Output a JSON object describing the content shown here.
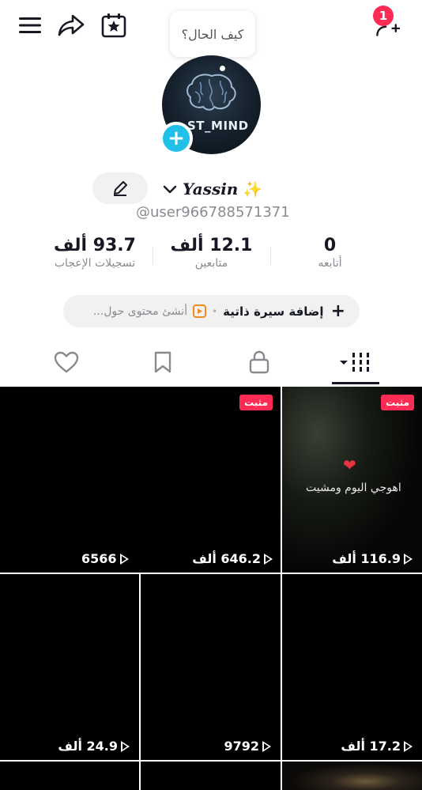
{
  "top_bar": {
    "notification_count": "1",
    "icons": [
      "menu-icon",
      "share-icon",
      "calendar-star-icon",
      "add-friend-icon"
    ]
  },
  "status_bubble": {
    "text": "كيف الحال؟"
  },
  "avatar": {
    "text": "ST_MIND"
  },
  "profile": {
    "display_name": "Yassin",
    "username": "@user966788571371"
  },
  "stats": [
    {
      "value": "93.7 ألف",
      "label": "تسجيلات الإعجاب"
    },
    {
      "value": "12.1 ألف",
      "label": "متابعين"
    },
    {
      "value": "0",
      "label": "أتابعه"
    }
  ],
  "bio": {
    "add_label": "إضافة سيرة ذاتية",
    "hint": "أنشئ محتوى حول..."
  },
  "tabs": [
    {
      "name": "liked",
      "icon": "heart-icon"
    },
    {
      "name": "favorites",
      "icon": "bookmark-icon"
    },
    {
      "name": "private",
      "icon": "lock-icon"
    },
    {
      "name": "videos",
      "icon": "grid-icon",
      "active": true
    }
  ],
  "videos": [
    {
      "views": "116.9 ألف",
      "pinned": "مثبت",
      "caption": "اهوجي اليوم ومشيت"
    },
    {
      "views": "646.2 ألف",
      "pinned": "مثبت"
    },
    {
      "views": "6566"
    },
    {
      "views": "17.2 ألف"
    },
    {
      "views": "9792"
    },
    {
      "views": "24.9 ألف"
    }
  ],
  "colors": {
    "accent": "#fe2c55",
    "avatar_plus": "#20c0e8",
    "bio_icon": "#f28a1c",
    "text_primary": "#161823",
    "text_secondary": "#8a8b91"
  }
}
